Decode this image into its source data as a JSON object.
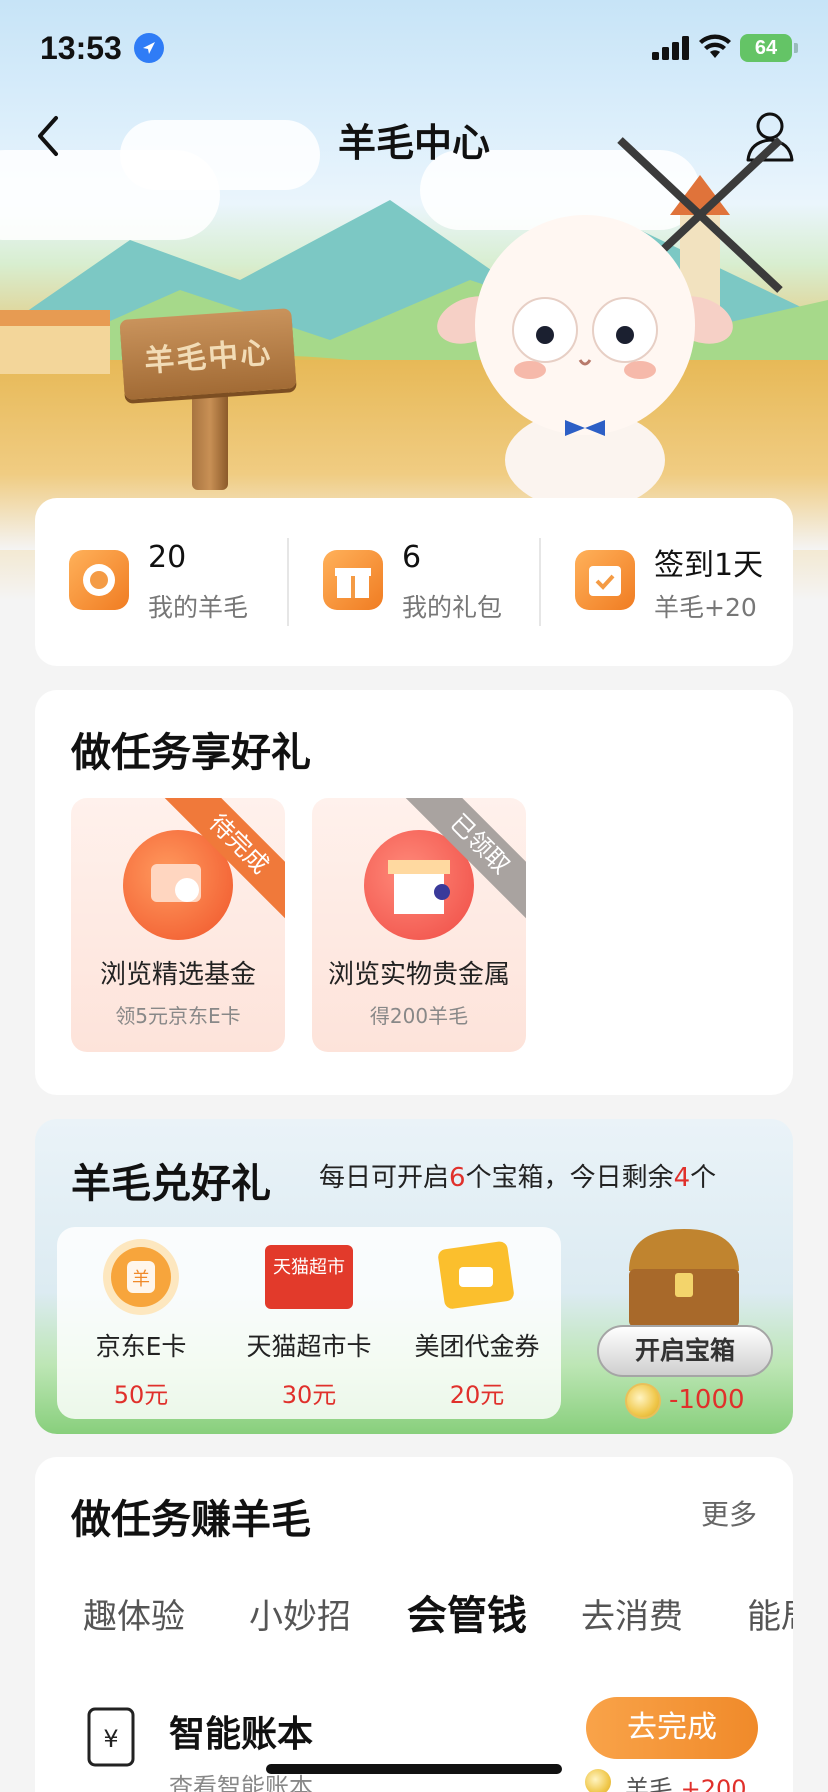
{
  "status_bar": {
    "time": "13:53",
    "battery": "64"
  },
  "nav": {
    "title": "羊毛中心"
  },
  "hero": {
    "sign_text": "羊毛中心"
  },
  "stats": [
    {
      "value": "20",
      "label": "我的羊毛",
      "icon": "sheep-flower-icon"
    },
    {
      "value": "6",
      "label": "我的礼包",
      "icon": "gift-icon"
    },
    {
      "value": "签到1天",
      "label": "羊毛+20",
      "icon": "calendar-check-icon"
    }
  ],
  "task_gifts": {
    "title": "做任务享好礼",
    "items": [
      {
        "name": "浏览精选基金",
        "sub": "领5元京东E卡",
        "ribbon": "待完成",
        "ribbon_color": "#f0793a"
      },
      {
        "name": "浏览实物贵金属",
        "sub": "得200羊毛",
        "ribbon": "已领取",
        "ribbon_color": "#a9a3a0"
      }
    ]
  },
  "exchange": {
    "title": "羊毛兑好礼",
    "desc_a": "每日可开启",
    "desc_n1": "6",
    "desc_b": "个宝箱，今日剩余",
    "desc_n2": "4",
    "desc_c": "个",
    "items": [
      {
        "name": "京东E卡",
        "price": "50元",
        "icon": "jd-card-icon"
      },
      {
        "name": "天猫超市卡",
        "price": "30元",
        "icon": "tmall-card-icon",
        "badge": "天猫超市"
      },
      {
        "name": "美团代金券",
        "price": "20元",
        "icon": "meituan-coupon-icon"
      }
    ],
    "open_button": "开启宝箱",
    "cost": "-1000"
  },
  "earn": {
    "title": "做任务赚羊毛",
    "more": "更多",
    "tabs": [
      "趣体验",
      "小妙招",
      "会管钱",
      "去消费",
      "能局"
    ],
    "active_tab": 2,
    "task": {
      "name": "智能账本",
      "desc": "查看智能账本",
      "button": "去完成",
      "reward_label": "羊毛",
      "reward_value": "+200"
    }
  },
  "colors": {
    "accent_orange": "#f08a2a",
    "price_red": "#e0302b"
  }
}
